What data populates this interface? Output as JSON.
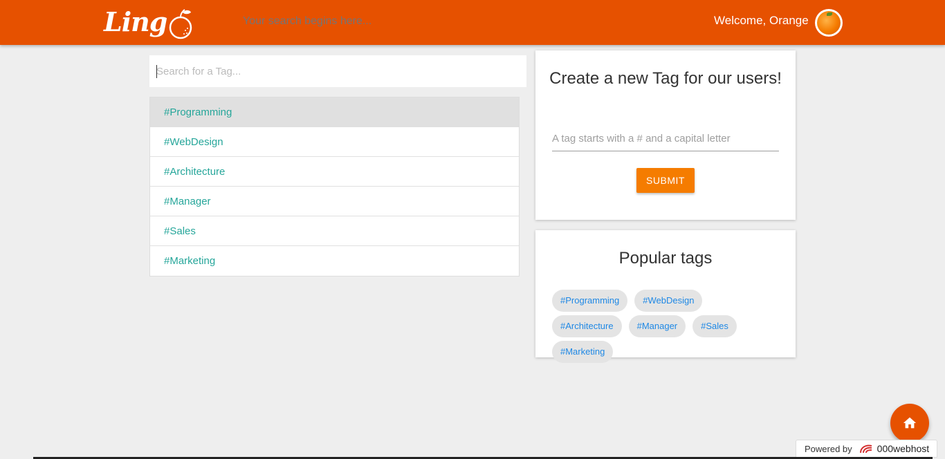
{
  "header": {
    "logo_text": "Ling",
    "search_placeholder": "Your search begins here...",
    "welcome": "Welcome, Orange",
    "avatar_icon": "orange-avatar",
    "color": "#e65100"
  },
  "tag_search": {
    "placeholder": "Search for a Tag..."
  },
  "tag_list": [
    {
      "label": "#Programming"
    },
    {
      "label": "#WebDesign"
    },
    {
      "label": "#Architecture"
    },
    {
      "label": "#Manager"
    },
    {
      "label": "#Sales"
    },
    {
      "label": "#Marketing"
    }
  ],
  "create_card": {
    "title": "Create a new Tag for our users!",
    "input_placeholder": "A tag starts with a # and a capital letter",
    "submit_label": "SUBMIT"
  },
  "popular_card": {
    "title": "Popular tags",
    "chips": [
      {
        "label": "#Programming"
      },
      {
        "label": "#WebDesign"
      },
      {
        "label": "#Architecture"
      },
      {
        "label": "#Manager"
      },
      {
        "label": "#Sales"
      },
      {
        "label": "#Marketing"
      }
    ]
  },
  "fab": {
    "icon": "home-icon"
  },
  "footer": {
    "powered_by": "Powered by",
    "brand": "000webhost"
  },
  "colors": {
    "accent": "#e65100",
    "button": "#f57c00",
    "tag_text": "#26a69a",
    "chip_text": "#1e88e5"
  }
}
